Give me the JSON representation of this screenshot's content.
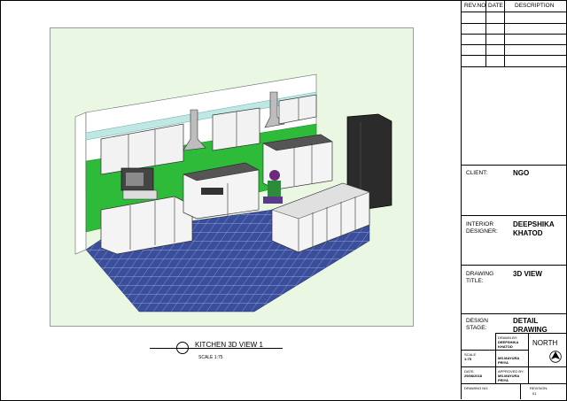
{
  "revision_table": {
    "headers": [
      "REV.NO",
      "DATE",
      "DESCRIPTION"
    ]
  },
  "title_block": {
    "client_label": "CLIENT:",
    "client_value": "NGO",
    "designer_label_1": "INTERIOR",
    "designer_label_2": "DESIGNER:",
    "designer_value_1": "DEEPSHIKA",
    "designer_value_2": "KHATOD",
    "drawing_title_label_1": "DRAWING",
    "drawing_title_label_2": "TITLE:",
    "drawing_title_value": "3D VIEW",
    "design_stage_label_1": "DESIGN",
    "design_stage_label_2": "STAGE:",
    "design_stage_value_1": "DETAIL",
    "design_stage_value_2": "DRAWING",
    "drawn_by_label": "DRAWN BY:",
    "drawn_by_value_1": "DEEPSHIKA",
    "drawn_by_value_2": "KHATOD",
    "north_label": "NORTH",
    "scale_label": "SCALE",
    "scale_value": "1:75",
    "checked_value_1": "MS.MAYURA",
    "checked_value_2": "PRIYA",
    "date_label": "DATE:",
    "date_value": "29/08/2018",
    "approved_label": "APPROVED BY:",
    "approved_value_1": "MS.MAYURA",
    "approved_value_2": "PRIYA",
    "drawing_no_label": "DRAWING NO:",
    "revision_label": "REVISION:",
    "revision_value": "01"
  },
  "caption": {
    "title": "KITCHEN 3D VIEW 1",
    "scale": "SCALE 1:75"
  },
  "colors": {
    "wall_green": "#2fbb3a",
    "floor_blue": "#3a4e9c",
    "panel_bg": "#eaf8e3",
    "fridge": "#2b2b2b"
  }
}
